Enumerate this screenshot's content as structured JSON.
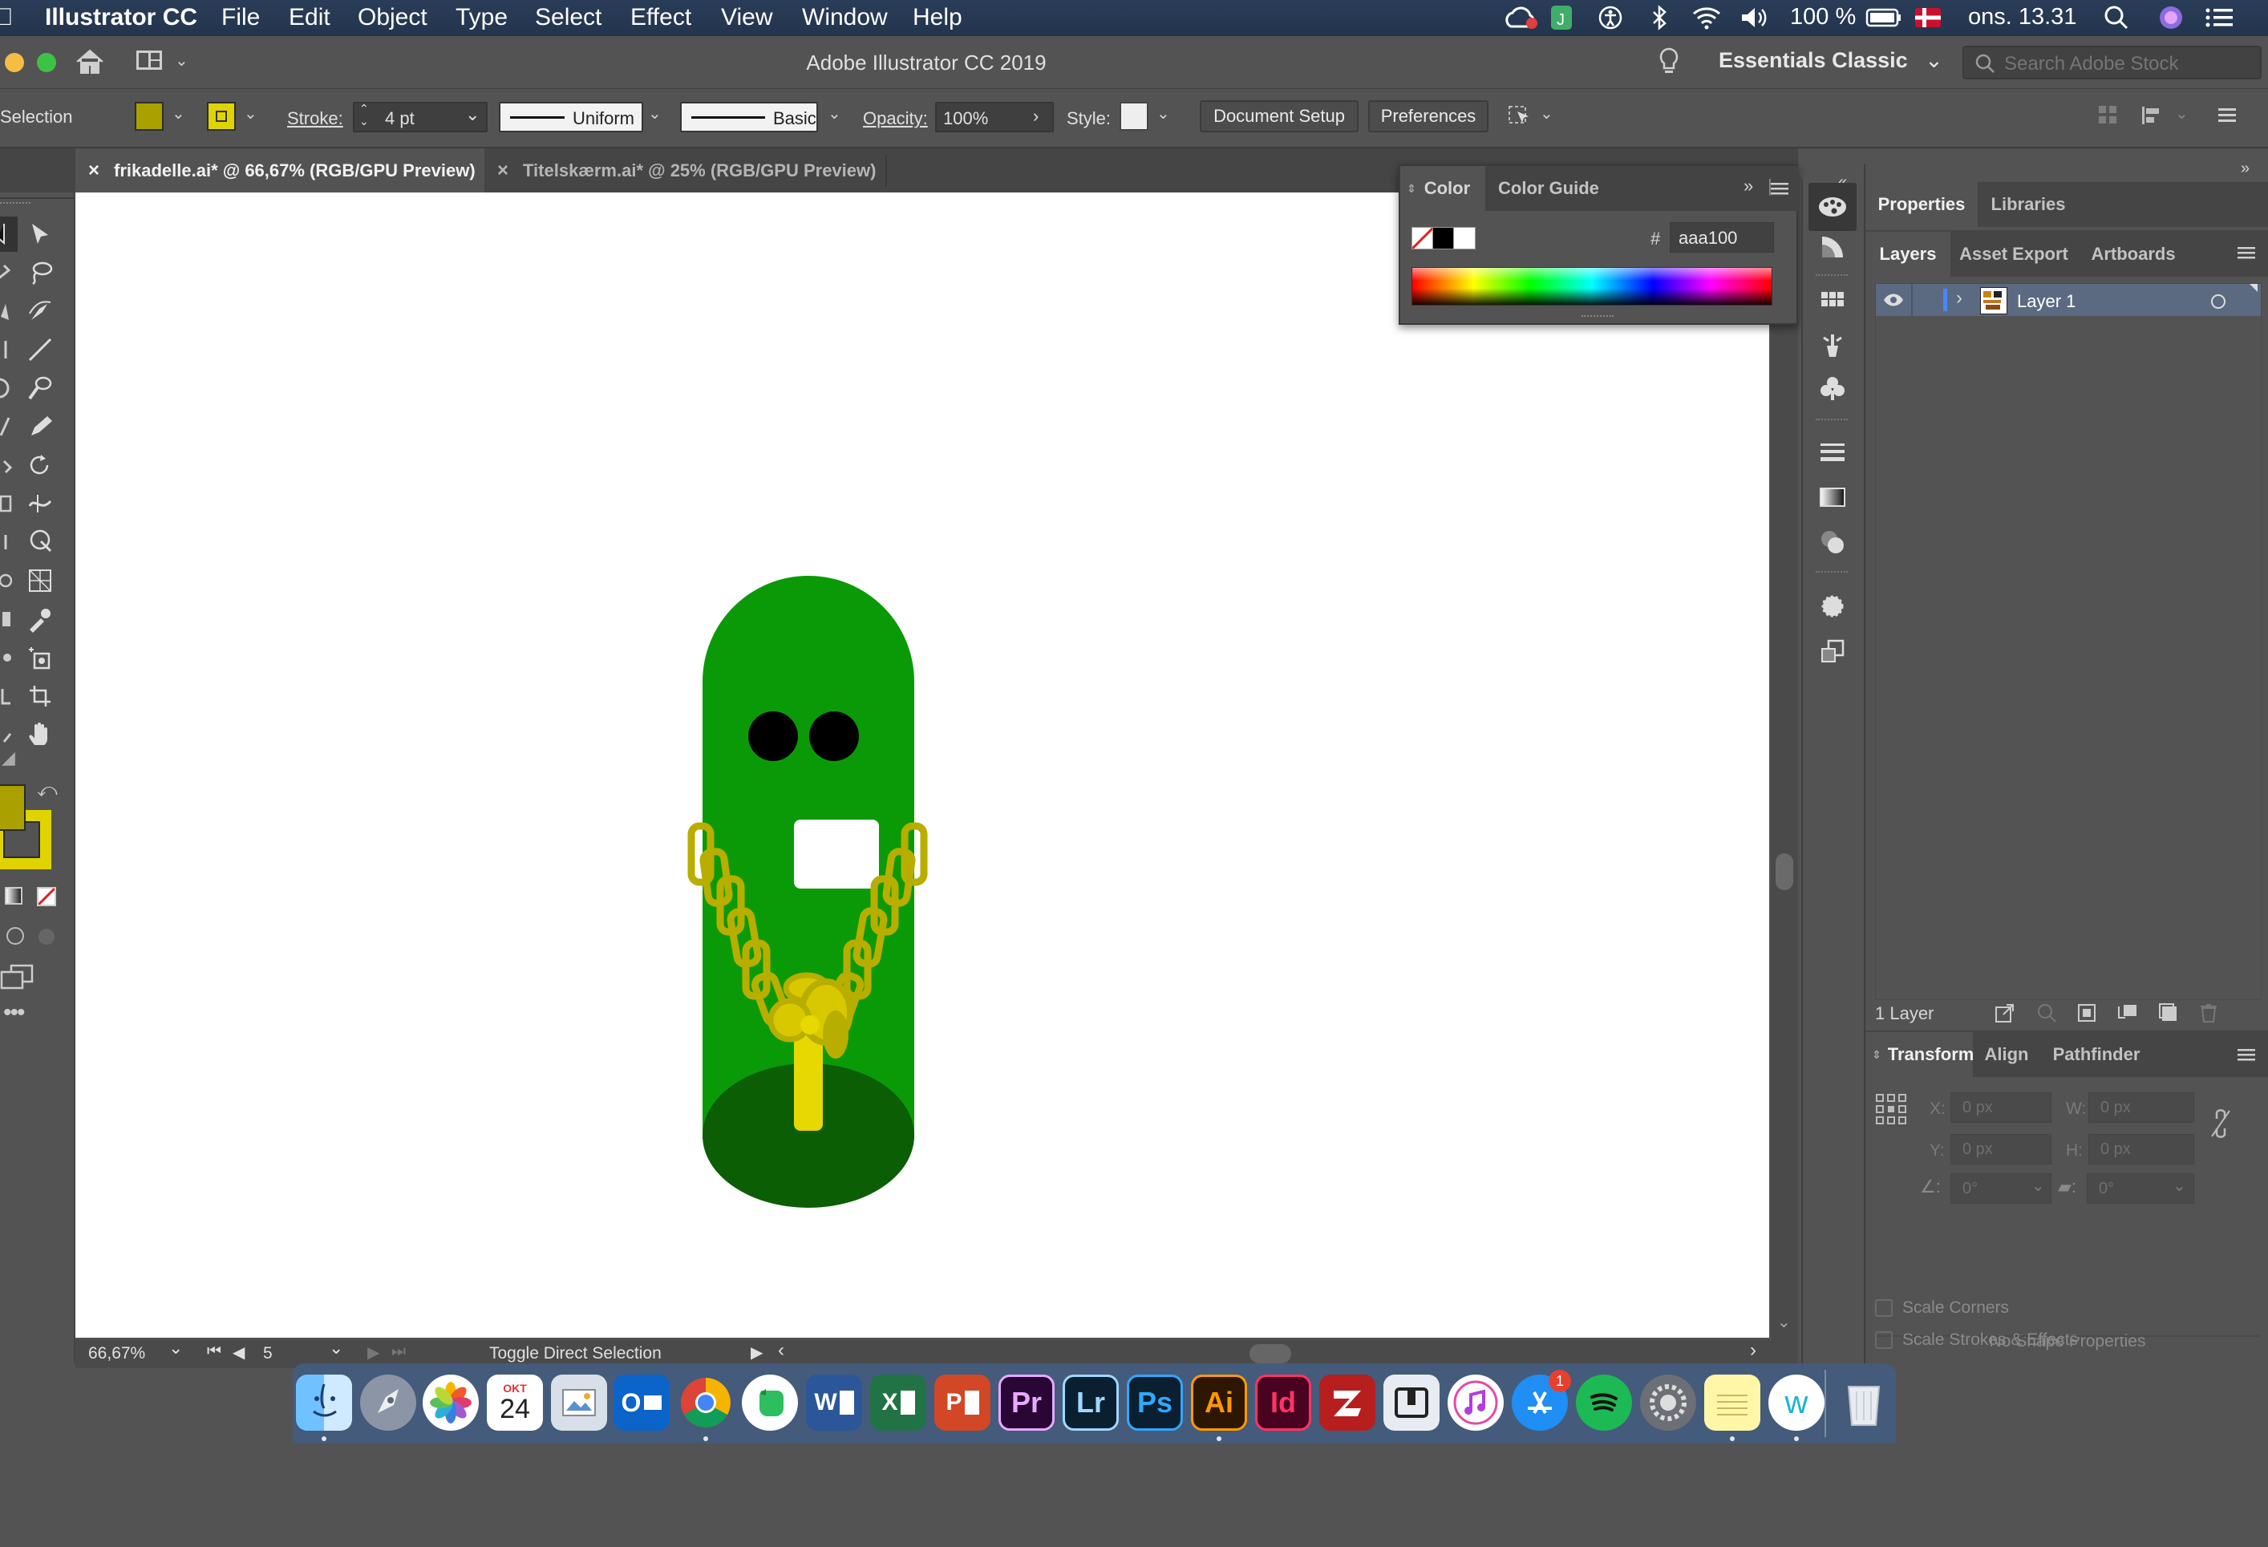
{
  "menubar": {
    "app_name": "Illustrator CC",
    "items": [
      "File",
      "Edit",
      "Object",
      "Type",
      "Select",
      "Effect",
      "View",
      "Window",
      "Help"
    ],
    "battery": "100 %",
    "clock": "ons. 13.31"
  },
  "titlebar": {
    "title": "Adobe Illustrator CC 2019",
    "workspace": "Essentials Classic",
    "stock_placeholder": "Search Adobe Stock"
  },
  "control": {
    "selection_label": "Selection",
    "fill_color": "#aaa100",
    "stroke_color": "#e0d400",
    "stroke_label": "Stroke:",
    "stroke_weight": "4 pt",
    "profile": "Uniform",
    "brush": "Basic",
    "opacity_label": "Opacity:",
    "opacity": "100%",
    "style_label": "Style:",
    "document_setup": "Document Setup",
    "preferences": "Preferences"
  },
  "tabs": [
    {
      "label": "frikadelle.ai* @ 66,67% (RGB/GPU Preview)",
      "active": true
    },
    {
      "label": "Titelskærm.ai* @ 25% (RGB/GPU Preview)",
      "active": false
    }
  ],
  "status": {
    "zoom": "66,67%",
    "artboard": "5",
    "tool_hint": "Toggle Direct Selection"
  },
  "color_panel": {
    "tab_color": "Color",
    "tab_guide": "Color Guide",
    "hex_symbol": "#",
    "hex": "aaa100"
  },
  "right_panel": {
    "tabs": [
      "Properties",
      "Libraries"
    ],
    "layer_tabs": [
      "Layers",
      "Asset Export",
      "Artboards"
    ],
    "layers": [
      {
        "name": "Layer 1"
      }
    ],
    "layer_count": "1 Layer",
    "transform_tabs": [
      "Transform",
      "Align",
      "Pathfinder"
    ],
    "x_label": "X:",
    "y_label": "Y:",
    "w_label": "W:",
    "h_label": "H:",
    "x": "0 px",
    "y": "0 px",
    "w": "0 px",
    "h": "0 px",
    "angle": "0°",
    "shear": "0°",
    "no_shape": "No Shape Properties",
    "scale_corners": "Scale Corners",
    "scale_strokes": "Scale Strokes & Effects"
  },
  "dock": {
    "calendar_month": "OKT",
    "calendar_day": "24",
    "appstore_badge": "1",
    "app_labels": [
      "Pr",
      "Lr",
      "Ps",
      "Ai",
      "Id"
    ]
  }
}
